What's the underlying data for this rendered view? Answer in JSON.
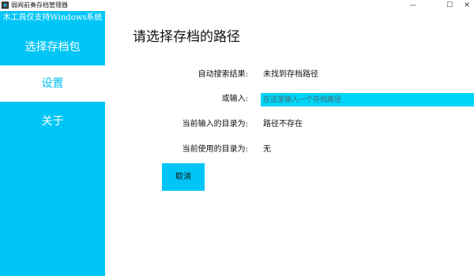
{
  "window": {
    "title": "弱闻前奏存档管理器",
    "min_glyph": "—",
    "max_glyph": "☐",
    "close_glyph": "✕"
  },
  "sidebar": {
    "subtitle": "木工具仅支持Windows系统",
    "items": [
      {
        "label": "选择存档包",
        "active": false
      },
      {
        "label": "设置",
        "active": true
      },
      {
        "label": "关于",
        "active": false
      }
    ],
    "accent_color": "#00c6f8"
  },
  "main": {
    "title": "请选择存档的路径",
    "auto_search_label": "自动搜索结果:",
    "auto_search_value": "未找到存档路径",
    "input_label": "或输入:",
    "input_placeholder": "在这里输入一个存档路径",
    "input_value": "",
    "current_input_label": "当前输入的目录为:",
    "current_input_value": "路径不存在",
    "current_used_label": "当前使用的目录为:",
    "current_used_value": "无",
    "cancel_label": "取消"
  }
}
